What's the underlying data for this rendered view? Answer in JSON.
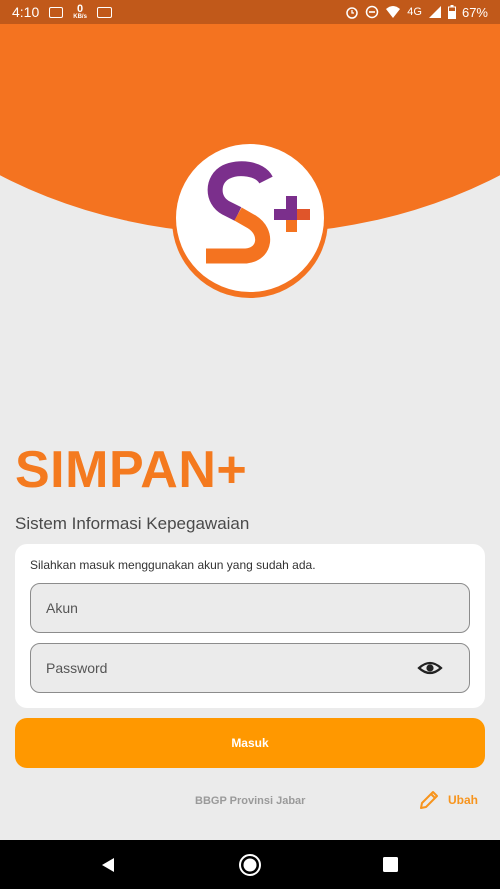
{
  "status_bar": {
    "time": "4:10",
    "net_speed_value": "0",
    "net_speed_unit": "KB/s",
    "network_type": "4G",
    "battery": "67%",
    "icons": [
      "image-icon",
      "translate-icon",
      "alarm-icon",
      "dnd-icon",
      "wifi-icon",
      "signal-icon",
      "battery-icon"
    ]
  },
  "app": {
    "title": "SIMPAN+",
    "subtitle": "Sistem Informasi Kepegawaian",
    "logo_letter": "S",
    "logo_plus": "+"
  },
  "login_card": {
    "hint": "Silahkan masuk menggunakan akun yang sudah ada.",
    "account_placeholder": "Akun",
    "password_placeholder": "Password",
    "password_toggle_icon": "eye-icon"
  },
  "login_button": {
    "label": "Masuk"
  },
  "footer": {
    "organization": "BBGP Provinsi Jabar",
    "change_label": "Ubah",
    "change_icon": "pencil-icon"
  },
  "colors": {
    "brand_orange": "#f47320",
    "button_orange": "#ff9800",
    "logo_purple": "#7b2f8c",
    "status_bar": "#c1591a"
  },
  "nav_bar": {
    "icons": [
      "back-icon",
      "home-icon",
      "recents-icon"
    ]
  }
}
